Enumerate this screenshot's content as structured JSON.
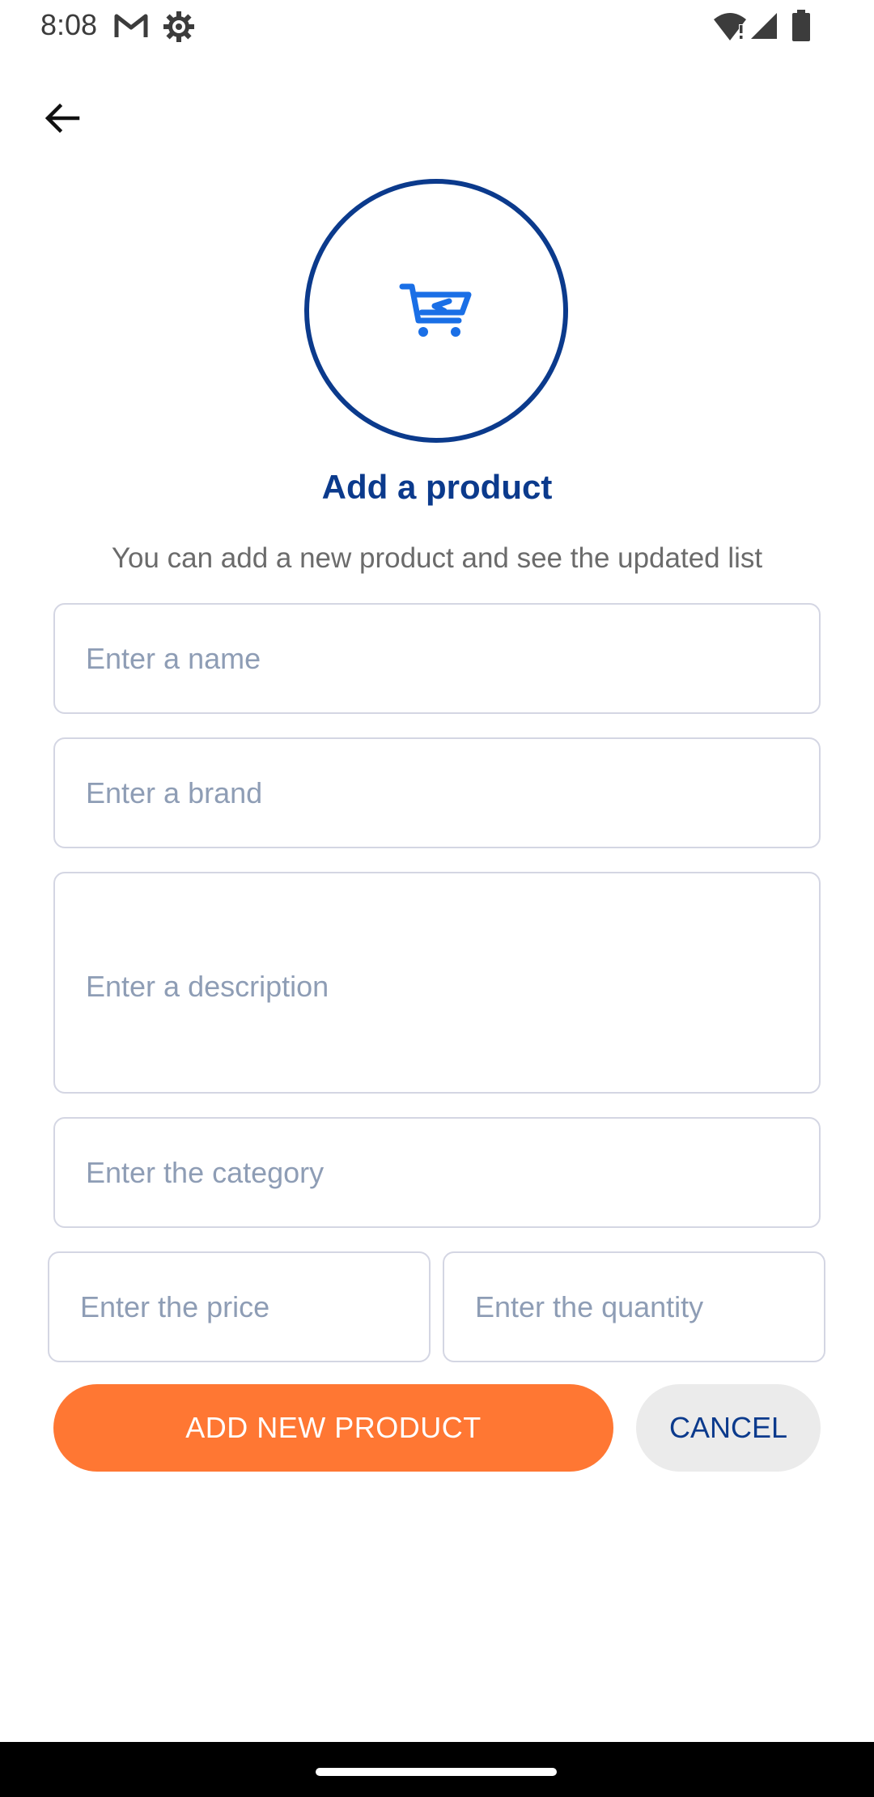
{
  "status_bar": {
    "time": "8:08",
    "icons": [
      "gmail-icon",
      "settings-gear-icon",
      "wifi-icon",
      "signal-icon",
      "battery-icon"
    ]
  },
  "header": {
    "back_icon": "arrow-back-icon"
  },
  "hero": {
    "icon": "shopping-cart-icon",
    "title": "Add a product",
    "subtitle": "You can add a new product and see the updated list"
  },
  "form": {
    "name_placeholder": "Enter a name",
    "brand_placeholder": "Enter a brand",
    "description_placeholder": "Enter a description",
    "category_placeholder": "Enter the category",
    "price_placeholder": "Enter the price",
    "quantity_placeholder": "Enter the quantity",
    "name_value": "",
    "brand_value": "",
    "description_value": "",
    "category_value": "",
    "price_value": "",
    "quantity_value": ""
  },
  "actions": {
    "add_label": "ADD NEW PRODUCT",
    "cancel_label": "CANCEL"
  },
  "colors": {
    "primary": "#0b3a8c",
    "accent": "#ff7733",
    "icon_blue": "#1a6fe6",
    "placeholder": "#8e9db5",
    "cancel_bg": "#ebebeb"
  }
}
